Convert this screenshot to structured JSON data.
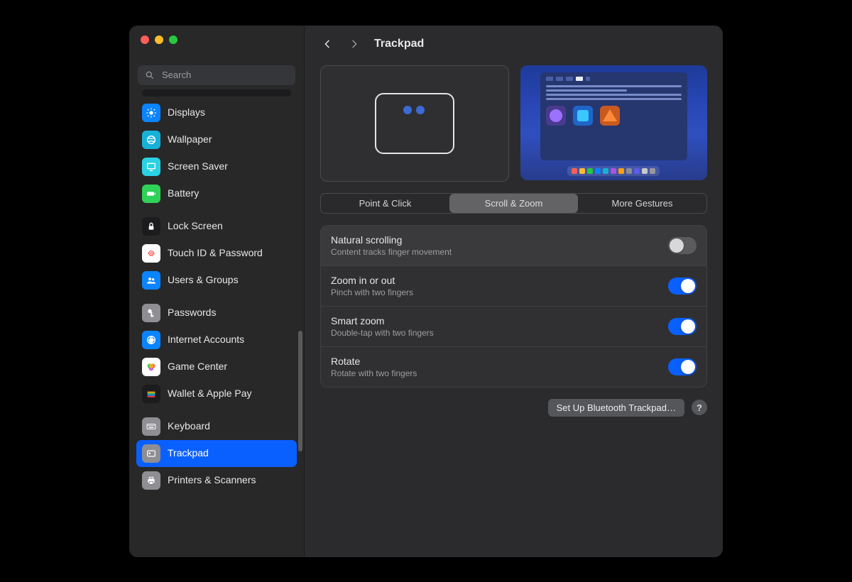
{
  "window": {
    "title": "Trackpad"
  },
  "search": {
    "placeholder": "Search"
  },
  "sidebar": {
    "groups": [
      {
        "items": [
          {
            "id": "displays",
            "label": "Displays"
          },
          {
            "id": "wallpaper",
            "label": "Wallpaper"
          },
          {
            "id": "screensaver",
            "label": "Screen Saver"
          },
          {
            "id": "battery",
            "label": "Battery"
          }
        ]
      },
      {
        "items": [
          {
            "id": "lockscreen",
            "label": "Lock Screen"
          },
          {
            "id": "touchid",
            "label": "Touch ID & Password"
          },
          {
            "id": "users",
            "label": "Users & Groups"
          }
        ]
      },
      {
        "items": [
          {
            "id": "passwords",
            "label": "Passwords"
          },
          {
            "id": "internet",
            "label": "Internet Accounts"
          },
          {
            "id": "gamecenter",
            "label": "Game Center"
          },
          {
            "id": "wallet",
            "label": "Wallet & Apple Pay"
          }
        ]
      },
      {
        "items": [
          {
            "id": "keyboard",
            "label": "Keyboard"
          },
          {
            "id": "trackpad",
            "label": "Trackpad",
            "selected": true
          },
          {
            "id": "printers",
            "label": "Printers & Scanners"
          }
        ]
      }
    ]
  },
  "tabs": {
    "point_click": "Point & Click",
    "scroll_zoom": "Scroll & Zoom",
    "more_gestures": "More Gestures",
    "active": "scroll_zoom"
  },
  "settings": {
    "natural_scrolling": {
      "title": "Natural scrolling",
      "sub": "Content tracks finger movement",
      "on": false
    },
    "zoom": {
      "title": "Zoom in or out",
      "sub": "Pinch with two fingers",
      "on": true
    },
    "smart_zoom": {
      "title": "Smart zoom",
      "sub": "Double-tap with two fingers",
      "on": true
    },
    "rotate": {
      "title": "Rotate",
      "sub": "Rotate with two fingers",
      "on": true
    }
  },
  "footer": {
    "setup_bluetooth": "Set Up Bluetooth Trackpad…",
    "help": "?"
  },
  "dock_colors": [
    "#ff5f57",
    "#febc2e",
    "#28c840",
    "#0a84ff",
    "#17b1d8",
    "#af52de",
    "#ff9f0a",
    "#8e8e93",
    "#5e5ce6",
    "#c7c7cc",
    "#98989d"
  ]
}
